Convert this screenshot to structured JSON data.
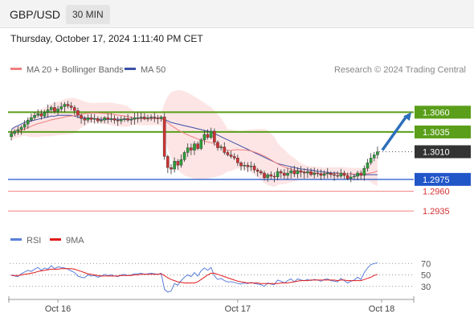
{
  "header": {
    "symbol": "GBP/USD",
    "timeframe": "30 MIN"
  },
  "timestamp": "Thursday, October 17, 2024 1:11:40 PM CET",
  "legend": {
    "ma20_label": "MA 20 + Bollinger Bands",
    "ma50_label": "MA 50",
    "credit": "Research © 2024 Trading Central"
  },
  "rsi_legend": {
    "rsi_label": "RSI",
    "ma_label": "9MA"
  },
  "colors": {
    "bull": "#2e9e3a",
    "bear": "#d23232",
    "ma20": "#f08080",
    "ma50": "#3c4fa6",
    "band_fill": "#fde0e0",
    "resistance": "#5a9e1a",
    "support": "#2156c9",
    "target": "#f08080",
    "price_box": "#333333",
    "rsi": "#5b7fd9",
    "rsi_ma": "#e11b1b",
    "arrow": "#2c6fbb"
  },
  "chart_data": {
    "type": "candlestick",
    "x_tick_labels": [
      "Oct 16",
      "Oct 17",
      "Oct 18"
    ],
    "y_range": [
      1.2927,
      1.3096
    ],
    "current_price": 1.301,
    "levels": [
      {
        "label": "1.3060",
        "value": 1.306,
        "kind": "resistance"
      },
      {
        "label": "1.3035",
        "value": 1.3035,
        "kind": "resistance"
      },
      {
        "label": "1.2975",
        "value": 1.2975,
        "kind": "support"
      },
      {
        "label": "1.2960",
        "value": 1.296,
        "kind": "target"
      },
      {
        "label": "1.2935",
        "value": 1.2935,
        "kind": "target"
      }
    ],
    "price_label": "1.3010",
    "closes": [
      1.3033,
      1.3036,
      1.3038,
      1.3041,
      1.3045,
      1.305,
      1.3053,
      1.3056,
      1.3058,
      1.3055,
      1.306,
      1.3063,
      1.3066,
      1.3061,
      1.3064,
      1.3067,
      1.307,
      1.3068,
      1.3066,
      1.3062,
      1.3056,
      1.3052,
      1.305,
      1.3053,
      1.3051,
      1.3052,
      1.3049,
      1.305,
      1.3053,
      1.3051,
      1.3052,
      1.305,
      1.3049,
      1.3051,
      1.3052,
      1.305,
      1.3051,
      1.3053,
      1.3053,
      1.3054,
      1.3052,
      1.3053,
      1.3054,
      1.3053,
      1.3052,
      1.3054,
      1.3004,
      1.299,
      1.2988,
      1.2998,
      1.2993,
      1.3,
      1.3009,
      1.3015,
      1.3012,
      1.302,
      1.3014,
      1.3025,
      1.3032,
      1.3028,
      1.3036,
      1.3022,
      1.3015,
      1.3016,
      1.3009,
      1.3006,
      1.3004,
      1.3002,
      1.2996,
      1.2992,
      1.2993,
      1.2991,
      1.2992,
      1.2987,
      1.2985,
      1.2983,
      1.2977,
      1.2981,
      1.2979,
      1.2978,
      1.2985,
      1.2983,
      1.298,
      1.2983,
      1.2986,
      1.2982,
      1.2986,
      1.2984,
      1.2983,
      1.2985,
      1.2981,
      1.2983,
      1.2982,
      1.298,
      1.2982,
      1.2983,
      1.2981,
      1.298,
      1.2979,
      1.2983,
      1.298,
      1.2976,
      1.2978,
      1.2979,
      1.2983,
      1.298,
      1.2989,
      1.2996,
      1.3002,
      1.3006,
      1.301
    ],
    "ma50": [
      1.3038,
      1.3041,
      1.3043,
      1.3045,
      1.3047,
      1.3048,
      1.3049,
      1.305,
      1.3051,
      1.3052,
      1.3053,
      1.3054,
      1.3055,
      1.3055,
      1.3056,
      1.3056,
      1.3056,
      1.3056,
      1.3056,
      1.3055,
      1.3054,
      1.3053,
      1.3053,
      1.3052,
      1.3052,
      1.3052,
      1.3051,
      1.3051,
      1.3051,
      1.3051,
      1.3051,
      1.3051,
      1.3051,
      1.3051,
      1.3051,
      1.3051,
      1.3051,
      1.3052,
      1.3052,
      1.3052,
      1.3052,
      1.3052,
      1.3052,
      1.3052,
      1.3052,
      1.3052,
      1.3051,
      1.3049,
      1.3047,
      1.3046,
      1.3045,
      1.3044,
      1.3043,
      1.3042,
      1.3041,
      1.304,
      1.3039,
      1.3038,
      1.3037,
      1.3036,
      1.3035,
      1.3033,
      1.3031,
      1.3029,
      1.3027,
      1.3025,
      1.3023,
      1.3021,
      1.3019,
      1.3017,
      1.3015,
      1.3013,
      1.3011,
      1.3009,
      1.3007,
      1.3005,
      1.3003,
      1.3001,
      1.2999,
      1.2997,
      1.2995,
      1.2994,
      1.2993,
      1.2992,
      1.2991,
      1.299,
      1.2989,
      1.2988,
      1.2988,
      1.2987,
      1.2987,
      1.2986,
      1.2985,
      1.2985,
      1.2984,
      1.2984,
      1.2983,
      1.2983,
      1.2983,
      1.2982,
      1.2982,
      1.2982,
      1.2982,
      1.2981,
      1.2981,
      1.2981,
      1.2981,
      1.2981,
      1.2981,
      1.2981,
      1.2981
    ],
    "rsi": {
      "ticks": [
        70,
        50,
        30
      ],
      "y_range": [
        10,
        90
      ],
      "values": [
        50,
        48,
        47,
        52,
        55,
        58,
        56,
        60,
        63,
        58,
        62,
        60,
        66,
        61,
        64,
        63,
        62,
        60,
        57,
        54,
        48,
        46,
        45,
        50,
        48,
        49,
        46,
        48,
        51,
        49,
        50,
        48,
        47,
        50,
        51,
        49,
        50,
        52,
        52,
        53,
        51,
        52,
        53,
        52,
        51,
        53,
        25,
        20,
        22,
        35,
        32,
        40,
        46,
        50,
        47,
        54,
        48,
        57,
        62,
        58,
        63,
        48,
        42,
        44,
        40,
        38,
        38,
        37,
        35,
        34,
        36,
        35,
        37,
        35,
        34,
        33,
        30,
        36,
        34,
        33,
        41,
        39,
        36,
        40,
        43,
        38,
        43,
        41,
        40,
        42,
        40,
        42,
        41,
        39,
        42,
        43,
        40,
        39,
        38,
        44,
        40,
        36,
        39,
        41,
        46,
        42,
        54,
        62,
        68,
        70,
        71
      ],
      "ma9": [
        49,
        49,
        49,
        50,
        51,
        52,
        53,
        54,
        56,
        57,
        58,
        59,
        60,
        60,
        60,
        61,
        61,
        61,
        61,
        60,
        58,
        56,
        54,
        52,
        51,
        50,
        49,
        48,
        48,
        48,
        48,
        48,
        48,
        49,
        49,
        49,
        49,
        50,
        50,
        51,
        51,
        51,
        51,
        51,
        51,
        52,
        49,
        45,
        42,
        40,
        38,
        37,
        36,
        36,
        36,
        36,
        38,
        42,
        46,
        50,
        53,
        53,
        51,
        49,
        47,
        45,
        43,
        41,
        39,
        38,
        37,
        36,
        36,
        36,
        36,
        35,
        35,
        35,
        35,
        35,
        35,
        36,
        36,
        36,
        37,
        38,
        39,
        40,
        40,
        40,
        41,
        41,
        41,
        41,
        41,
        41,
        41,
        41,
        40,
        41,
        41,
        40,
        40,
        40,
        40,
        40,
        42,
        44,
        46,
        49,
        51
      ]
    }
  }
}
